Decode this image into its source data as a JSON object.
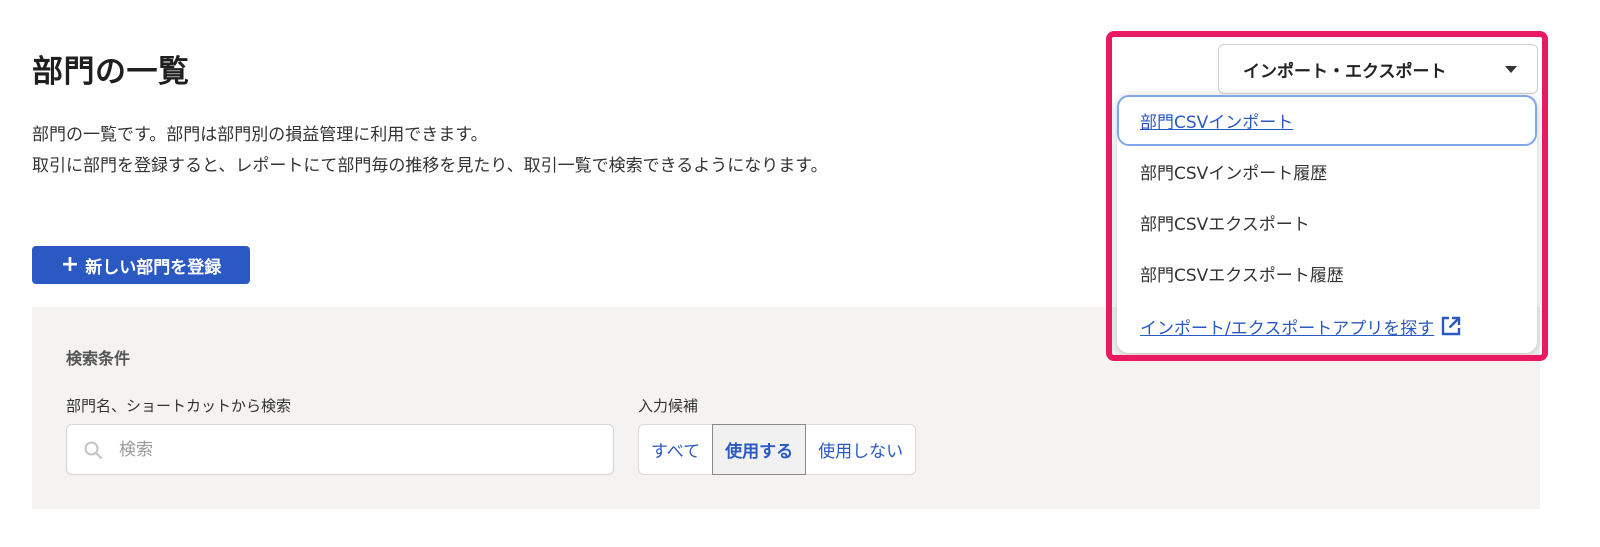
{
  "page": {
    "title": "部門の一覧",
    "description_lines": [
      "部門の一覧です。部門は部門別の損益管理に利用できます。",
      "取引に部門を登録すると、レポートにて部門毎の推移を見たり、取引一覧で検索できるようになります。"
    ],
    "add_button_label": "新しい部門を登録"
  },
  "search": {
    "heading": "検索条件",
    "label": "部門名、ショートカットから検索",
    "placeholder": "検索",
    "value": "",
    "filter_label": "入力候補",
    "filter_options": [
      "すべて",
      "使用する",
      "使用しない"
    ],
    "filter_selected": "使用する"
  },
  "import_export": {
    "toggle_label": "インポート・エクスポート",
    "menu_items": [
      "部門CSVインポート",
      "部門CSVインポート履歴",
      "部門CSVエクスポート",
      "部門CSVエクスポート履歴",
      "インポート/エクスポートアプリを探す"
    ]
  },
  "colors": {
    "primary": "#2b59c3",
    "highlight": "#ea1a62",
    "panel_bg": "#f4f3f2",
    "focus_ring": "#7ea6e8"
  },
  "icons": {
    "add": "plus-icon",
    "search": "search-icon",
    "dropdown": "caret-down-icon",
    "external": "external-link-icon"
  }
}
